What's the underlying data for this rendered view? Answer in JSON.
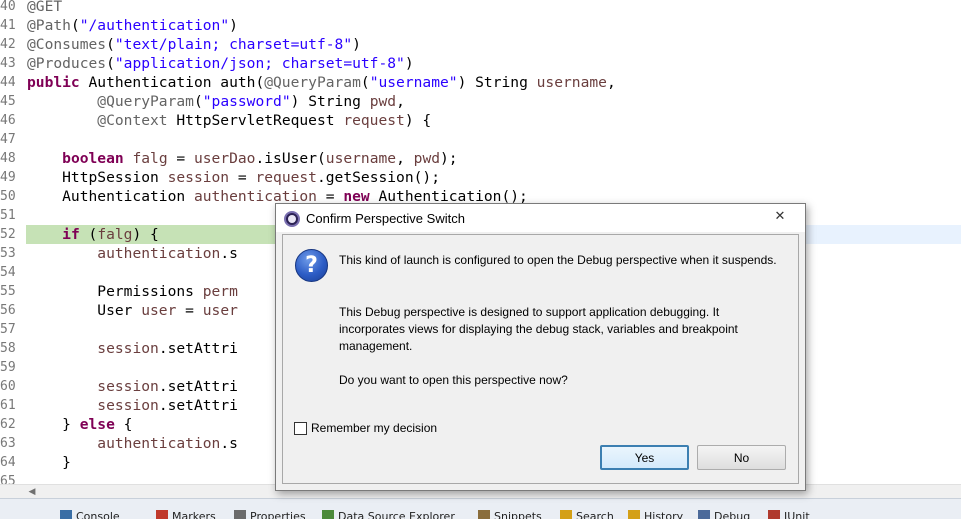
{
  "editor": {
    "lines": [
      {
        "ln": "40",
        "tokens": [
          [
            "ann",
            "@GET"
          ]
        ]
      },
      {
        "ln": "41",
        "tokens": [
          [
            "ann",
            "@Path"
          ],
          [
            "",
            "("
          ],
          [
            "str",
            "\"/authentication\""
          ],
          [
            "",
            ")"
          ]
        ]
      },
      {
        "ln": "42",
        "tokens": [
          [
            "ann",
            "@Consumes"
          ],
          [
            "",
            "("
          ],
          [
            "str",
            "\"text/plain; charset=utf-8\""
          ],
          [
            "",
            ")"
          ]
        ]
      },
      {
        "ln": "43",
        "tokens": [
          [
            "ann",
            "@Produces"
          ],
          [
            "",
            "("
          ],
          [
            "str",
            "\"application/json; charset=utf-8\""
          ],
          [
            "",
            ")"
          ]
        ]
      },
      {
        "ln": "44",
        "tokens": [
          [
            "kw",
            "public"
          ],
          [
            "",
            " Authentication auth("
          ],
          [
            "ann",
            "@QueryParam"
          ],
          [
            "",
            "("
          ],
          [
            "str",
            "\"username\""
          ],
          [
            "",
            ") String "
          ],
          [
            "var",
            "username"
          ],
          [
            "",
            ","
          ]
        ]
      },
      {
        "ln": "45",
        "tokens": [
          [
            "",
            "        "
          ],
          [
            "ann",
            "@QueryParam"
          ],
          [
            "",
            "("
          ],
          [
            "str",
            "\"password\""
          ],
          [
            "",
            ") String "
          ],
          [
            "var",
            "pwd"
          ],
          [
            "",
            ","
          ]
        ]
      },
      {
        "ln": "46",
        "tokens": [
          [
            "",
            "        "
          ],
          [
            "ann",
            "@Context"
          ],
          [
            "",
            " HttpServletRequest "
          ],
          [
            "var",
            "request"
          ],
          [
            "",
            ") {"
          ]
        ]
      },
      {
        "ln": "47",
        "tokens": []
      },
      {
        "ln": "48",
        "tokens": [
          [
            "",
            "    "
          ],
          [
            "kw",
            "boolean"
          ],
          [
            "",
            ""
          ],
          [
            "var",
            " falg"
          ],
          [
            "",
            " = "
          ],
          [
            "var",
            "userDao"
          ],
          [
            "",
            ".isUser("
          ],
          [
            "var",
            "username"
          ],
          [
            "",
            ", "
          ],
          [
            "var",
            "pwd"
          ],
          [
            "",
            ");"
          ]
        ]
      },
      {
        "ln": "49",
        "tokens": [
          [
            "",
            "    HttpSession "
          ],
          [
            "var",
            "session"
          ],
          [
            "",
            " = "
          ],
          [
            "var",
            "request"
          ],
          [
            "",
            ".getSession();"
          ]
        ]
      },
      {
        "ln": "50",
        "tokens": [
          [
            "",
            "    Authentication "
          ],
          [
            "var",
            "authentication"
          ],
          [
            "",
            " = "
          ],
          [
            "kw",
            "new"
          ],
          [
            "",
            " Authentication();"
          ]
        ]
      },
      {
        "ln": "51",
        "tokens": []
      },
      {
        "ln": "52",
        "tokens": [
          [
            "",
            "    "
          ],
          [
            "kw",
            "if"
          ],
          [
            "",
            " ("
          ],
          [
            "var",
            "falg"
          ],
          [
            "",
            ") {"
          ]
        ]
      },
      {
        "ln": "53",
        "tokens": [
          [
            "",
            "        "
          ],
          [
            "var",
            "authentication"
          ],
          [
            "",
            ".s"
          ]
        ]
      },
      {
        "ln": "54",
        "tokens": []
      },
      {
        "ln": "55",
        "tokens": [
          [
            "",
            "        Permissions "
          ],
          [
            "var",
            "perm"
          ]
        ]
      },
      {
        "ln": "56",
        "tokens": [
          [
            "",
            "        User "
          ],
          [
            "var",
            "user"
          ],
          [
            "",
            " = "
          ],
          [
            "var",
            "user"
          ]
        ]
      },
      {
        "ln": "57",
        "tokens": []
      },
      {
        "ln": "58",
        "tokens": [
          [
            "",
            "        "
          ],
          [
            "var",
            "session"
          ],
          [
            "",
            ".setAttri"
          ]
        ]
      },
      {
        "ln": "59",
        "tokens": []
      },
      {
        "ln": "60",
        "tokens": [
          [
            "",
            "        "
          ],
          [
            "var",
            "session"
          ],
          [
            "",
            ".setAttri"
          ]
        ]
      },
      {
        "ln": "61",
        "tokens": [
          [
            "",
            "        "
          ],
          [
            "var",
            "session"
          ],
          [
            "",
            ".setAttri"
          ]
        ]
      },
      {
        "ln": "62",
        "tokens": [
          [
            "",
            "    } "
          ],
          [
            "kw",
            "else"
          ],
          [
            "",
            " {"
          ]
        ]
      },
      {
        "ln": "63",
        "tokens": [
          [
            "",
            "        "
          ],
          [
            "var",
            "authentication"
          ],
          [
            "",
            ".s"
          ]
        ]
      },
      {
        "ln": "64",
        "tokens": [
          [
            "",
            "    }"
          ]
        ]
      },
      {
        "ln": "65",
        "tokens": []
      }
    ]
  },
  "bottom_tabs": [
    "Console",
    "Markers",
    "Properties",
    "Data Source Explorer",
    "Snippets",
    "Search",
    "History",
    "Debug",
    "JUnit"
  ],
  "dialog": {
    "title": "Confirm Perspective Switch",
    "close_label": "✕",
    "message1": "This kind of launch is configured to open the Debug perspective when it suspends.",
    "message2": "This Debug perspective is designed to support application debugging.  It incorporates views for displaying the debug stack, variables and breakpoint management.",
    "message3": "Do you want to open this perspective now?",
    "remember_label": "Remember my decision",
    "yes_label": "Yes",
    "no_label": "No"
  }
}
